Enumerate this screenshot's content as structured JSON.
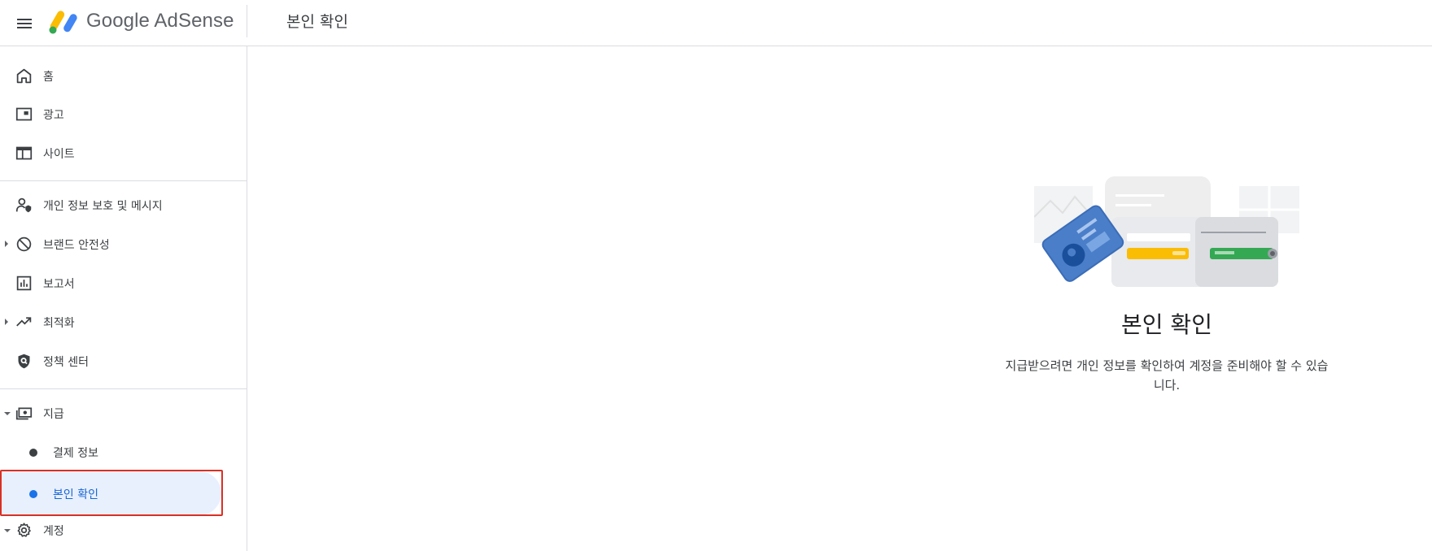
{
  "header": {
    "logo_text": "Google AdSense",
    "page_title": "본인 확인"
  },
  "sidebar": {
    "items": [
      {
        "label": "홈",
        "icon": "home-icon"
      },
      {
        "label": "광고",
        "icon": "ads-icon"
      },
      {
        "label": "사이트",
        "icon": "sites-icon"
      },
      {
        "label": "개인 정보 보호 및 메시지",
        "icon": "privacy-messaging-icon"
      },
      {
        "label": "브랜드 안전성",
        "icon": "block-icon"
      },
      {
        "label": "보고서",
        "icon": "reports-icon"
      },
      {
        "label": "최적화",
        "icon": "trending-icon"
      },
      {
        "label": "정책 센터",
        "icon": "policy-shield-icon"
      },
      {
        "label": "지급",
        "icon": "payments-icon"
      },
      {
        "label": "계정",
        "icon": "gear-icon"
      }
    ],
    "payments_sub": [
      {
        "label": "결제 정보"
      },
      {
        "label": "본인 확인",
        "active": true
      }
    ]
  },
  "main": {
    "heading": "본인 확인",
    "description": "지급받으려면 개인 정보를 확인하여 계정을 준비해야 할 수 있습니다."
  },
  "colors": {
    "accent": "#1a73e8",
    "active_bg": "#e8f0fe",
    "highlight": "#d93025"
  }
}
